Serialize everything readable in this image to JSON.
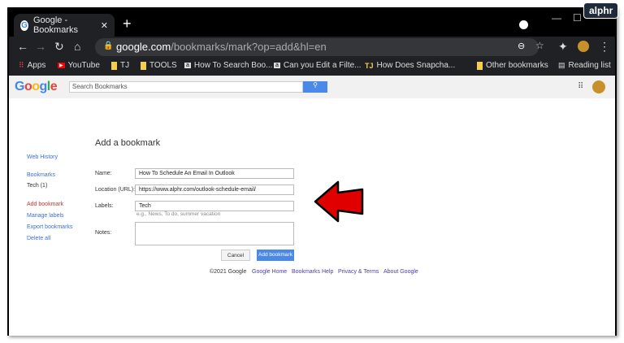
{
  "watermark": "alphr",
  "tab": {
    "title": "Google - Bookmarks"
  },
  "address": {
    "domain": "google.com",
    "path": "/bookmarks/mark?op=add&hl=en"
  },
  "bookmarks_bar": [
    "Apps",
    "YouTube",
    "TJ",
    "TOOLS",
    "How To Search Boo...",
    "Can you Edit a Filte...",
    "How Does Snapcha...",
    "Other bookmarks",
    "Reading list"
  ],
  "header": {
    "logo": "Google",
    "search_placeholder": "Search Bookmarks"
  },
  "sidebar": {
    "web_history": "Web History",
    "bookmarks": "Bookmarks",
    "tech": "Tech (1)",
    "add": "Add bookmark",
    "manage": "Manage labels",
    "export": "Export bookmarks",
    "delete": "Delete all"
  },
  "form": {
    "title": "Add a bookmark",
    "name_label": "Name:",
    "name_value": "How To Schedule An Email In Outlook",
    "url_label": "Location (URL):",
    "url_value": "https://www.alphr.com/outlook-schedule-email/",
    "labels_label": "Labels:",
    "labels_value": "Tech",
    "labels_hint": "e.g., News, To do, summer vacation",
    "notes_label": "Notes:",
    "cancel": "Cancel",
    "submit": "Add bookmark"
  },
  "footer": {
    "copyright": "©2021 Google",
    "links": [
      "Google Home",
      "Bookmarks Help",
      "Privacy & Terms",
      "About Google"
    ]
  },
  "colors": {
    "accent": "#4a89e8",
    "arrow": "#e00000"
  }
}
